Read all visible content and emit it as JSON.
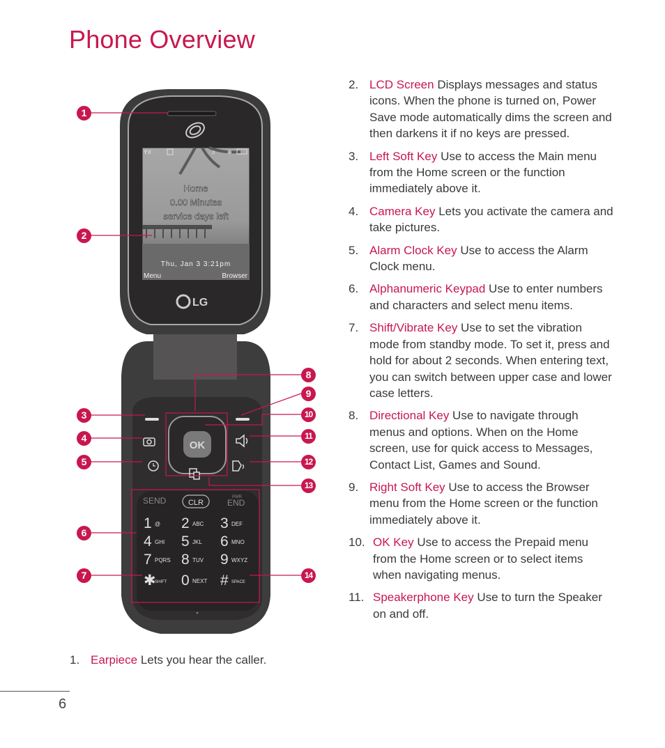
{
  "page": {
    "title": "Phone Overview",
    "page_number": "6",
    "accent_color": "#c8174f"
  },
  "phone": {
    "screen": {
      "home": "Home",
      "minutes": "0.00 Minutes",
      "days": "service days left",
      "datetime": "Thu, Jan 3  3:21pm",
      "left_softkey": "Menu",
      "right_softkey": "Browser",
      "status_icons": [
        "signal-icon",
        "1x-network-icon",
        "music-icon",
        "location-icon",
        "battery-icon"
      ]
    },
    "brand": "LG",
    "keys": {
      "ok": "OK",
      "send": "SEND",
      "clr": "CLR",
      "pwr": "PWR",
      "end": "END",
      "keypad": [
        {
          "digit": "1",
          "letters": "@"
        },
        {
          "digit": "2",
          "letters": "ABC"
        },
        {
          "digit": "3",
          "letters": "DEF"
        },
        {
          "digit": "4",
          "letters": "GHI"
        },
        {
          "digit": "5",
          "letters": "JKL"
        },
        {
          "digit": "6",
          "letters": "MNO"
        },
        {
          "digit": "7",
          "letters": "PQRS"
        },
        {
          "digit": "8",
          "letters": "TUV"
        },
        {
          "digit": "9",
          "letters": "WXYZ"
        },
        {
          "digit": "✱",
          "letters": "SHIFT"
        },
        {
          "digit": "0",
          "letters": "NEXT"
        },
        {
          "digit": "#",
          "letters": "SPACE"
        }
      ]
    },
    "callouts": [
      "1",
      "2",
      "3",
      "4",
      "5",
      "6",
      "7",
      "8",
      "9",
      "10",
      "11",
      "12",
      "13",
      "14"
    ]
  },
  "items": [
    {
      "num": "1.",
      "term": "Earpiece",
      "desc": " Lets you hear the caller."
    },
    {
      "num": "2.",
      "term": "LCD Screen",
      "desc": " Displays messages and status icons. When the phone is turned on, Power Save mode automatically dims the screen and then darkens it if no keys are pressed."
    },
    {
      "num": "3.",
      "term": "Left Soft Key",
      "desc": " Use to access the Main menu from the Home screen or the function immediately above it."
    },
    {
      "num": "4.",
      "term": "Camera Key",
      "desc": " Lets you activate the camera and take pictures."
    },
    {
      "num": "5.",
      "term": "Alarm Clock Key",
      "desc": " Use to access the Alarm Clock menu."
    },
    {
      "num": "6.",
      "term": "Alphanumeric Keypad",
      "desc": " Use to enter numbers and characters and select menu items."
    },
    {
      "num": "7.",
      "term": "Shift/Vibrate Key",
      "desc": " Use to set the vibration mode from standby mode. To set it, press and hold for about 2 seconds. When entering text, you can switch between upper case and lower case letters."
    },
    {
      "num": "8.",
      "term": "Directional Key",
      "desc": " Use to navigate through menus and options. When on the Home screen, use for quick access to Messages, Contact List, Games and Sound."
    },
    {
      "num": "9.",
      "term": "Right Soft Key",
      "desc": " Use to access the Browser menu from the Home screen or the function immediately above it."
    },
    {
      "num": "10.",
      "term": "OK Key",
      "desc": " Use to access the Prepaid menu from the Home screen or to select items when navigating menus."
    },
    {
      "num": "11.",
      "term": "Speakerphone Key",
      "desc": " Use to turn the Speaker on and off."
    }
  ]
}
